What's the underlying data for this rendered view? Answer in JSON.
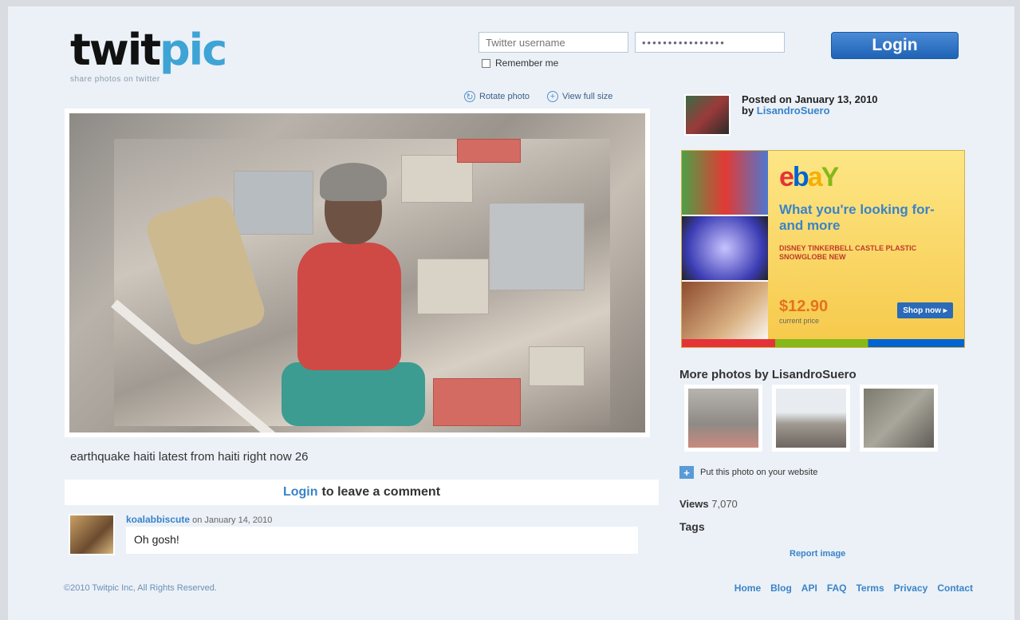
{
  "header": {
    "logo_part1": "twit",
    "logo_part2": "pic",
    "tagline": "share photos on twitter"
  },
  "login": {
    "username_placeholder": "Twitter username",
    "password_value": "••••••••••••••••",
    "remember_label": "Remember me",
    "button_label": "Login"
  },
  "photo_tools": {
    "rotate_label": "Rotate photo",
    "fullsize_label": "View full size"
  },
  "photo": {
    "caption": "earthquake haiti latest from haiti right now 26"
  },
  "comments": {
    "login_link": "Login",
    "login_suffix": "to leave a comment",
    "items": [
      {
        "author": "koalabbiscute",
        "date": "on January 14, 2010",
        "text": "Oh gosh!"
      }
    ]
  },
  "sidebar": {
    "posted_prefix": "Posted on January 13, 2010",
    "posted_by": "by",
    "username": "LisandroSuero",
    "ad": {
      "brand_e": "e",
      "brand_b": "b",
      "brand_a": "a",
      "brand_y": "Y",
      "headline": "What you're looking for-and more",
      "product": "DISNEY TINKERBELL CASTLE PLASTIC SNOWGLOBE NEW",
      "price": "$12.90",
      "price_sub": "current price",
      "shop_label": "Shop now ▸"
    },
    "more_title": "More photos by LisandroSuero",
    "embed_label": "Put this photo on your website",
    "views_label": "Views",
    "views_count": "7,070",
    "tags_label": "Tags",
    "report_label": "Report image"
  },
  "footer": {
    "copyright": "©2010 Twitpic Inc, All Rights Reserved.",
    "links": [
      "Home",
      "Blog",
      "API",
      "FAQ",
      "Terms",
      "Privacy",
      "Contact"
    ]
  }
}
